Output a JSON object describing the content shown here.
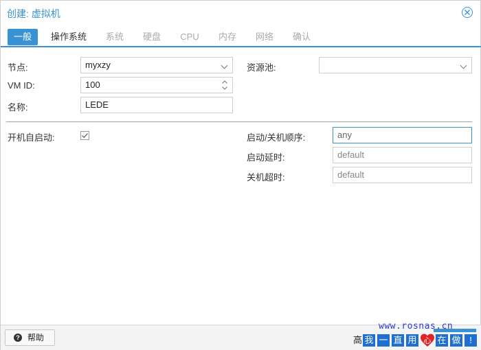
{
  "dialog": {
    "title": "创建: 虚拟机"
  },
  "tabs": [
    {
      "label": "一般"
    },
    {
      "label": "操作系统"
    },
    {
      "label": "系统"
    },
    {
      "label": "硬盘"
    },
    {
      "label": "CPU"
    },
    {
      "label": "内存"
    },
    {
      "label": "网络"
    },
    {
      "label": "确认"
    }
  ],
  "form": {
    "node_label": "节点:",
    "node_value": "myxzy",
    "vmid_label": "VM ID:",
    "vmid_value": "100",
    "name_label": "名称:",
    "name_value": "LEDE",
    "pool_label": "资源池:",
    "pool_value": "",
    "onboot_label": "开机自启动:",
    "onboot_checked": true,
    "order_label": "启动/关机顺序:",
    "order_value": "any",
    "delay_label": "启动延时:",
    "delay_placeholder": "default",
    "shutdown_label": "关机超时:",
    "shutdown_placeholder": "default"
  },
  "footer": {
    "help_label": "帮助",
    "advanced_label": "高"
  },
  "watermark": {
    "url": "www.rosnas.cn",
    "chars": [
      "我",
      "一",
      "直",
      "用",
      "心",
      "在",
      "做",
      "!"
    ]
  },
  "colors": {
    "accent": "#3892d4",
    "watermark_blue": "#1f6fd1",
    "watermark_heart": "#e0242a"
  }
}
